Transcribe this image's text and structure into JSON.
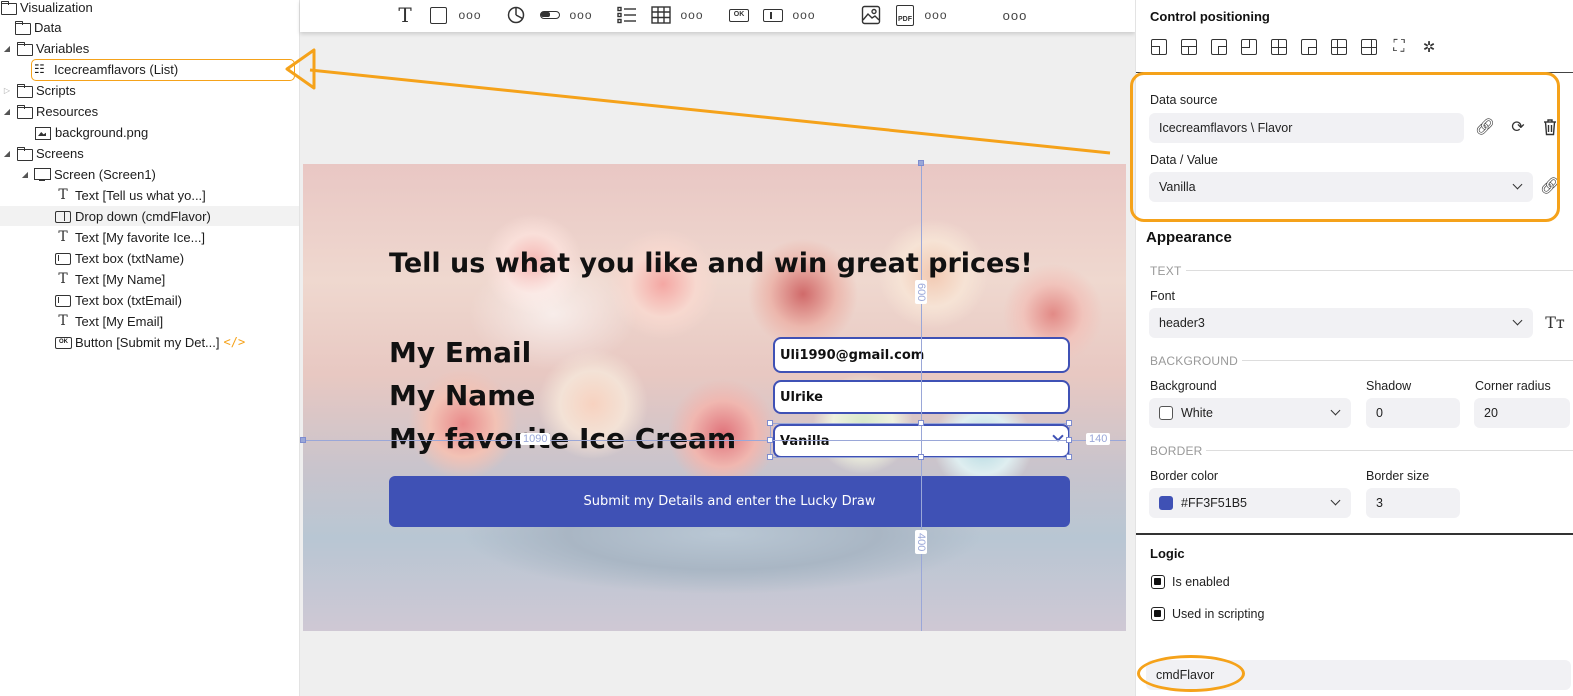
{
  "tree": {
    "items": [
      {
        "label": "Visualization"
      },
      {
        "label": "Data"
      },
      {
        "label": "Variables"
      },
      {
        "label": "Icecreamflavors (List)"
      },
      {
        "label": "Scripts"
      },
      {
        "label": "Resources"
      },
      {
        "label": "background.png"
      },
      {
        "label": "Screens"
      },
      {
        "label": "Screen (Screen1)"
      },
      {
        "label": "Text [Tell us what yo...]"
      },
      {
        "label": "Drop down  (cmdFlavor)"
      },
      {
        "label": "Text [My favorite Ice...]"
      },
      {
        "label": "Text box  (txtName)"
      },
      {
        "label": "Text [My Name]"
      },
      {
        "label": "Text box  (txtEmail)"
      },
      {
        "label": "Text [My Email]"
      },
      {
        "label": "Button [Submit my Det...]"
      }
    ],
    "code_tag": "</>"
  },
  "toolbar": {
    "text_tool": "T",
    "more": "ooo",
    "ok_label": "OK",
    "pdf_label": "PDF",
    "overflow": "ooo"
  },
  "screen": {
    "heading": "Tell us what you like and win great prices!",
    "email_label": "My Email",
    "email_value": "Uli1990@gmail.com",
    "name_label": "My Name",
    "name_value": "Ulrike",
    "flavor_label": "My favorite Ice Cream",
    "flavor_value": "Vanilla",
    "submit_label": "Submit my Details and enter the Lucky Draw"
  },
  "guides": {
    "top": "600",
    "bottom": "400",
    "left": "1090",
    "right": "140"
  },
  "props": {
    "positioning_title": "Control positioning",
    "data_source_label": "Data source",
    "data_source_value": "Icecreamflavors \\ Flavor",
    "data_value_label": "Data / Value",
    "data_value_value": "Vanilla",
    "appearance_title": "Appearance",
    "text_section": "TEXT",
    "font_label": "Font",
    "font_value": "header3",
    "background_section": "BACKGROUND",
    "background_label": "Background",
    "background_value": "White",
    "shadow_label": "Shadow",
    "shadow_value": "0",
    "corner_label": "Corner radius",
    "corner_value": "20",
    "border_section": "BORDER",
    "border_color_label": "Border color",
    "border_color_value": "#FF3F51B5",
    "border_size_label": "Border size",
    "border_size_value": "3",
    "logic_title": "Logic",
    "enabled_label": "Is enabled",
    "scripting_label": "Used in scripting",
    "control_name": "cmdFlavor"
  },
  "colors": {
    "accent": "#3f51b5",
    "highlight": "#f5a21a"
  }
}
